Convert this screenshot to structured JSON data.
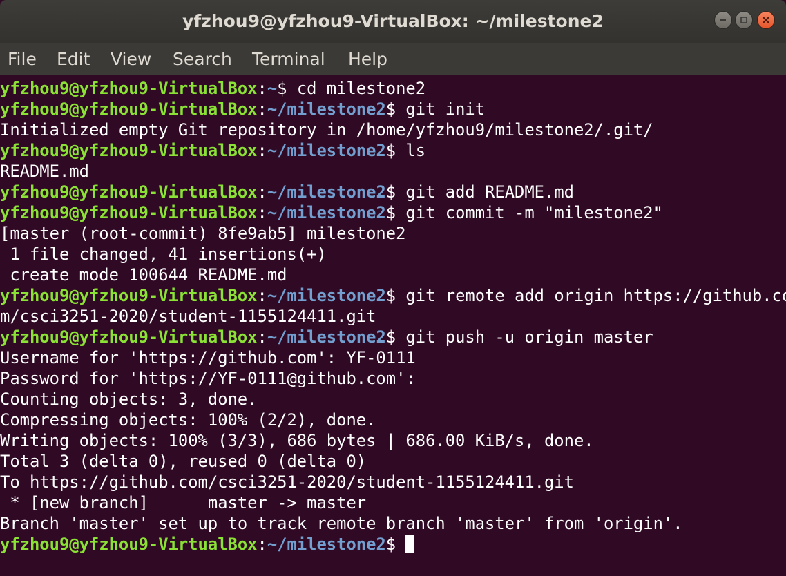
{
  "window": {
    "title": "yfzhou9@yfzhou9-VirtualBox: ~/milestone2",
    "controls": [
      "minimize-icon",
      "maximize-icon",
      "close-icon"
    ]
  },
  "menu": {
    "file": "File",
    "edit": "Edit",
    "view": "View",
    "search": "Search",
    "terminal": "Terminal",
    "help": "Help"
  },
  "colors": {
    "background": "#300a24",
    "prompt_user": "#8ae234",
    "prompt_path": "#729fcf",
    "text": "#ffffff"
  },
  "terminal": {
    "lines": [
      {
        "user": "yfzhou9@yfzhou9-VirtualBox",
        "sep": ":",
        "path": "~",
        "cmd": "$ cd milestone2"
      },
      {
        "user": "yfzhou9@yfzhou9-VirtualBox",
        "sep": ":",
        "path": "~/milestone2",
        "cmd": "$ git init"
      },
      {
        "text": "Initialized empty Git repository in /home/yfzhou9/milestone2/.git/"
      },
      {
        "user": "yfzhou9@yfzhou9-VirtualBox",
        "sep": ":",
        "path": "~/milestone2",
        "cmd": "$ ls"
      },
      {
        "text": "README.md"
      },
      {
        "user": "yfzhou9@yfzhou9-VirtualBox",
        "sep": ":",
        "path": "~/milestone2",
        "cmd": "$ git add README.md"
      },
      {
        "user": "yfzhou9@yfzhou9-VirtualBox",
        "sep": ":",
        "path": "~/milestone2",
        "cmd": "$ git commit -m \"milestone2\""
      },
      {
        "text": "[master (root-commit) 8fe9ab5] milestone2"
      },
      {
        "text": " 1 file changed, 41 insertions(+)"
      },
      {
        "text": " create mode 100644 README.md"
      },
      {
        "user": "yfzhou9@yfzhou9-VirtualBox",
        "sep": ":",
        "path": "~/milestone2",
        "cmd": "$ git remote add origin https://github.co"
      },
      {
        "text": "m/csci3251-2020/student-1155124411.git"
      },
      {
        "user": "yfzhou9@yfzhou9-VirtualBox",
        "sep": ":",
        "path": "~/milestone2",
        "cmd": "$ git push -u origin master"
      },
      {
        "text": "Username for 'https://github.com': YF-0111"
      },
      {
        "text": "Password for 'https://YF-0111@github.com':"
      },
      {
        "text": "Counting objects: 3, done."
      },
      {
        "text": "Compressing objects: 100% (2/2), done."
      },
      {
        "text": "Writing objects: 100% (3/3), 686 bytes | 686.00 KiB/s, done."
      },
      {
        "text": "Total 3 (delta 0), reused 0 (delta 0)"
      },
      {
        "text": "To https://github.com/csci3251-2020/student-1155124411.git"
      },
      {
        "text": " * [new branch]      master -> master"
      },
      {
        "text": "Branch 'master' set up to track remote branch 'master' from 'origin'."
      },
      {
        "user": "yfzhou9@yfzhou9-VirtualBox",
        "sep": ":",
        "path": "~/milestone2",
        "cmd": "$ "
      }
    ]
  }
}
